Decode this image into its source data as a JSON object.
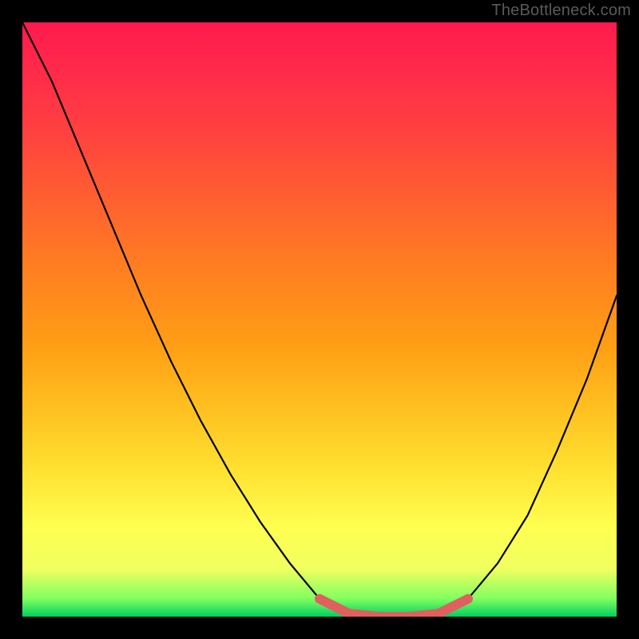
{
  "watermark": "TheBottleneck.com",
  "chart_data": {
    "type": "line",
    "title": "",
    "xlabel": "",
    "ylabel": "",
    "x": [
      0.0,
      0.05,
      0.1,
      0.15,
      0.2,
      0.25,
      0.3,
      0.35,
      0.4,
      0.45,
      0.5,
      0.55,
      0.6,
      0.65,
      0.7,
      0.75,
      0.8,
      0.85,
      0.9,
      0.95,
      1.0
    ],
    "series": [
      {
        "name": "bottleneck-curve",
        "values": [
          1.0,
          0.9,
          0.78,
          0.66,
          0.54,
          0.43,
          0.33,
          0.24,
          0.16,
          0.09,
          0.03,
          0.005,
          0.0,
          0.0,
          0.005,
          0.03,
          0.09,
          0.17,
          0.28,
          0.4,
          0.54
        ]
      },
      {
        "name": "optimal-region-indicator",
        "values": [
          null,
          null,
          null,
          null,
          null,
          null,
          null,
          null,
          null,
          null,
          0.03,
          0.005,
          0.0,
          0.0,
          0.005,
          0.03,
          null,
          null,
          null,
          null,
          null
        ]
      }
    ],
    "xlim": [
      0,
      1
    ],
    "ylim": [
      0,
      1
    ],
    "annotations": [],
    "legend": false,
    "grid": false
  },
  "colors": {
    "background": "#000000",
    "curve": "#000000",
    "indicator": "#e06060",
    "gradient_top": "#ff1a4d",
    "gradient_bottom": "#00d060"
  }
}
